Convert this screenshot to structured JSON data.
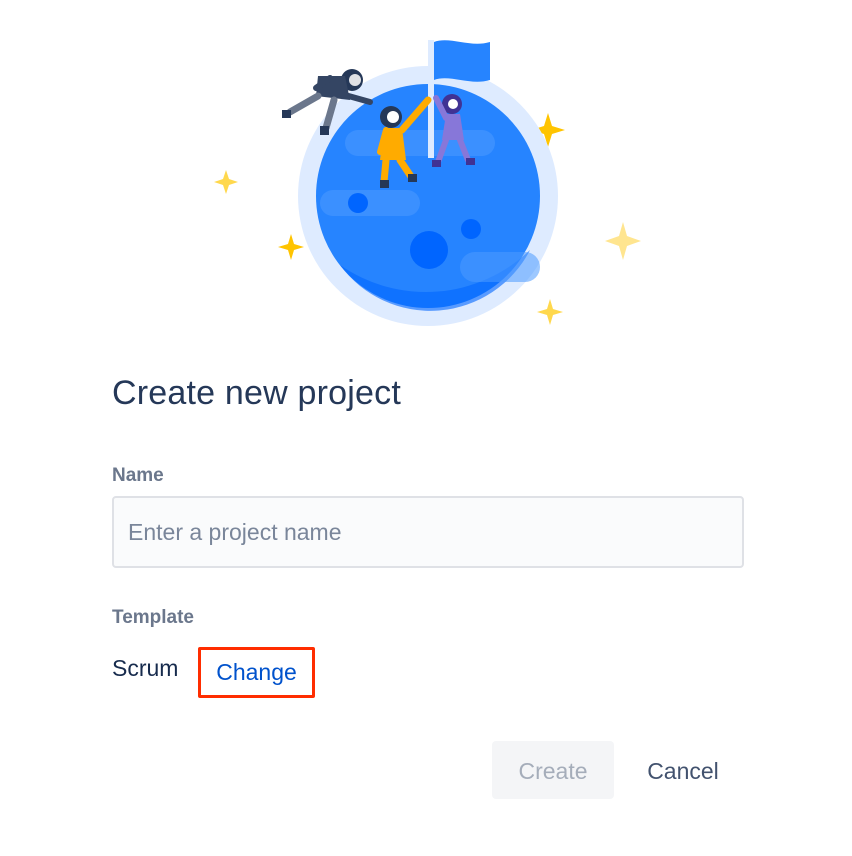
{
  "dialog": {
    "title": "Create new project"
  },
  "name_field": {
    "label": "Name",
    "value": "",
    "placeholder": "Enter a project name"
  },
  "template_field": {
    "label": "Template",
    "value": "Scrum",
    "change_link": "Change"
  },
  "buttons": {
    "create": "Create",
    "cancel": "Cancel"
  },
  "colors": {
    "title": "#253858",
    "label": "#6b778c",
    "link": "#0052cc",
    "highlight_border": "#ff2d00",
    "planet": "#2684ff",
    "planet_halo": "#deebff",
    "sparkle": "#ffc400"
  },
  "icons": {
    "illustration": "astronauts-planet-illustration",
    "sparkle": "sparkle-icon",
    "flag": "flag-icon"
  }
}
